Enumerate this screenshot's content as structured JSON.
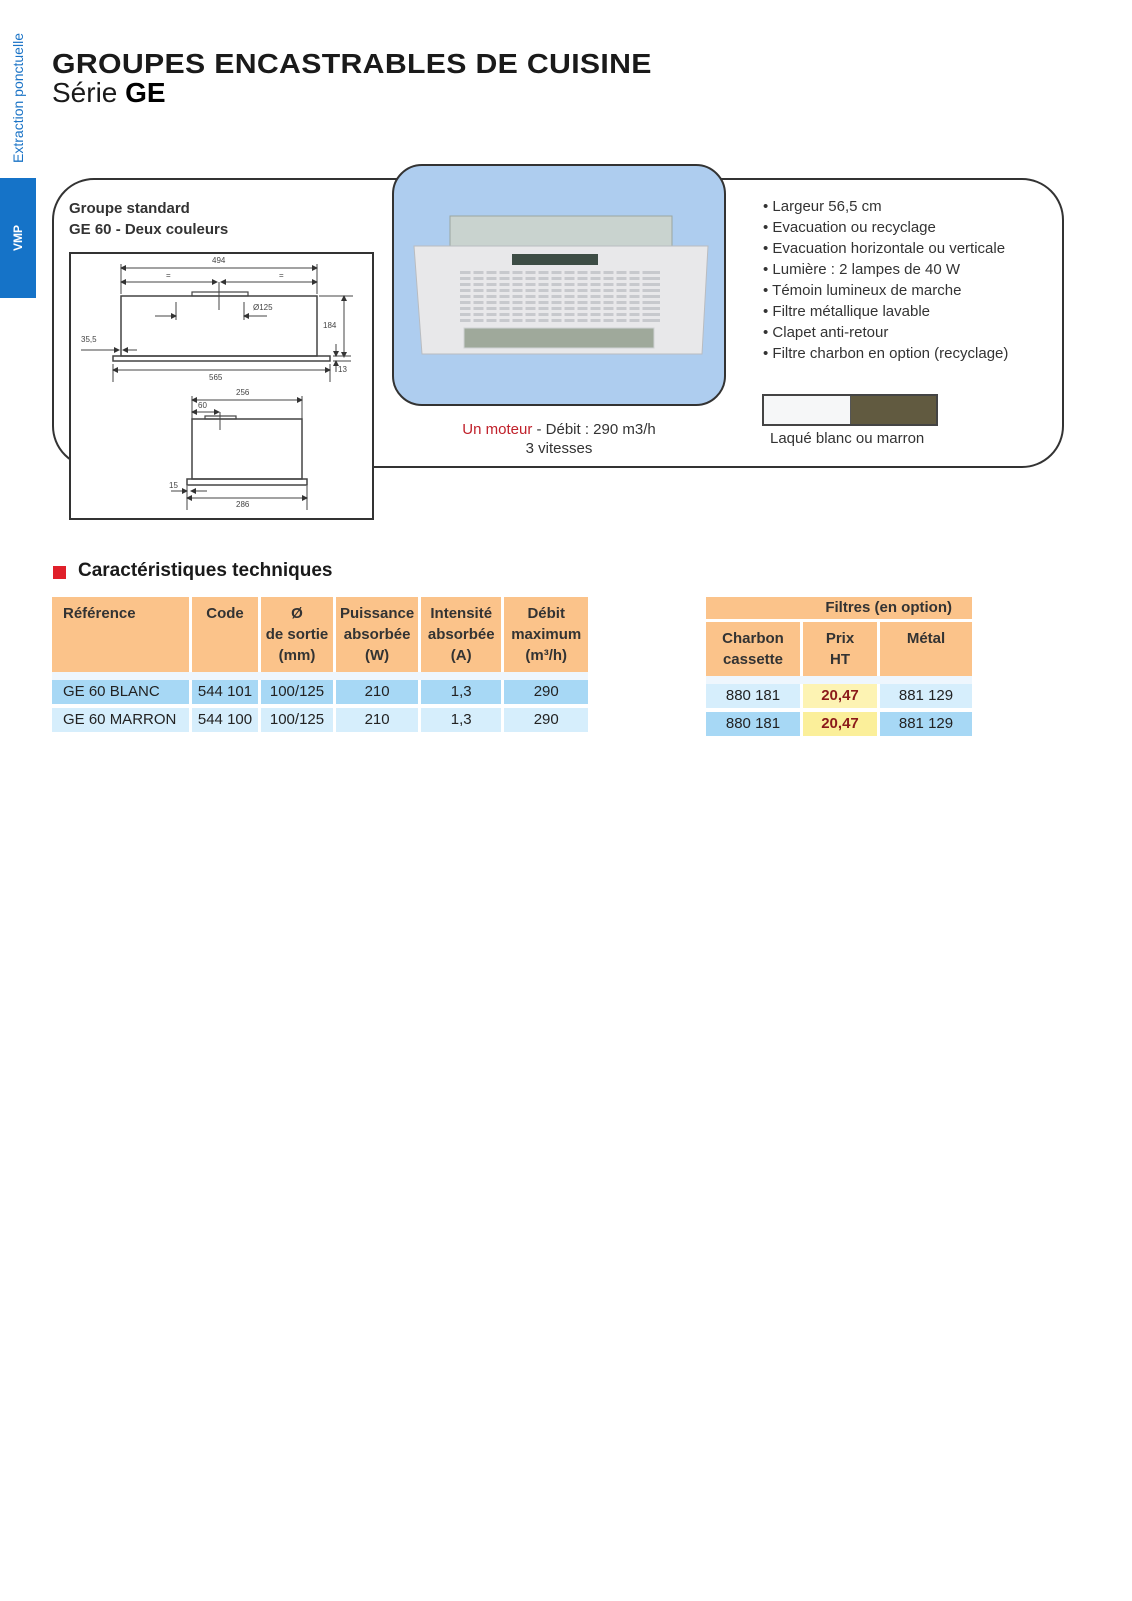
{
  "sidebar": {
    "section_label": "Extraction ponctuelle",
    "active_tab": "VMP"
  },
  "header": {
    "title": "GROUPES ENCASTRABLES DE CUISINE",
    "subtitle_prefix": "Série",
    "subtitle_series": "GE"
  },
  "product": {
    "group_label": "Groupe standard",
    "model_label": "GE 60 - Deux couleurs",
    "drawing_dimensions": {
      "front_width_top": "494",
      "half_left": "=",
      "half_right": "=",
      "duct_diameter": "Ø125",
      "height": "184",
      "offset_left": "35,5",
      "front_width": "565",
      "panel_thickness": "13",
      "side_depth": "256",
      "side_duct_offset": "60",
      "side_offset": "15",
      "side_total_depth": "286"
    },
    "motor_highlight": "Un moteur",
    "motor_rest": " - Débit : 290 m3/h",
    "speeds": "3 vitesses",
    "features": [
      "Largeur 56,5 cm",
      "Evacuation ou recyclage",
      "Evacuation horizontale ou verticale",
      "Lumière : 2 lampes de 40 W",
      "Témoin lumineux de marche",
      "Filtre métallique lavable",
      "Clapet anti-retour",
      "Filtre charbon en option (recyclage)"
    ],
    "color_swatches": [
      {
        "name": "Laqué blanc",
        "color": "#f6f7f8"
      },
      {
        "name": "Marron",
        "color": "#615a40"
      }
    ],
    "colors_label": "Laqué blanc ou marron"
  },
  "specs": {
    "section_title": "Caractéristiques techniques",
    "columns": [
      [
        "Référence"
      ],
      [
        "Code"
      ],
      [
        "Ø",
        "de sortie",
        "(mm)"
      ],
      [
        "Puissance",
        "absorbée",
        "(W)"
      ],
      [
        "Intensité",
        "absorbée",
        "(A)"
      ],
      [
        "Débit",
        "maximum",
        "(m³/h)"
      ]
    ],
    "rows": [
      [
        "GE 60 BLANC",
        "544 101",
        "100/125",
        "210",
        "1,3",
        "290"
      ],
      [
        "GE 60 MARRON",
        "544 100",
        "100/125",
        "210",
        "1,3",
        "290"
      ]
    ]
  },
  "filters": {
    "title": "Filtres (en option)",
    "columns": [
      [
        "Charbon",
        "cassette"
      ],
      [
        "Prix",
        "HT"
      ],
      [
        "Métal"
      ]
    ],
    "rows": [
      [
        "880 181",
        "20,47",
        "881 129"
      ],
      [
        "880 181",
        "20,47",
        "881 129"
      ]
    ]
  }
}
